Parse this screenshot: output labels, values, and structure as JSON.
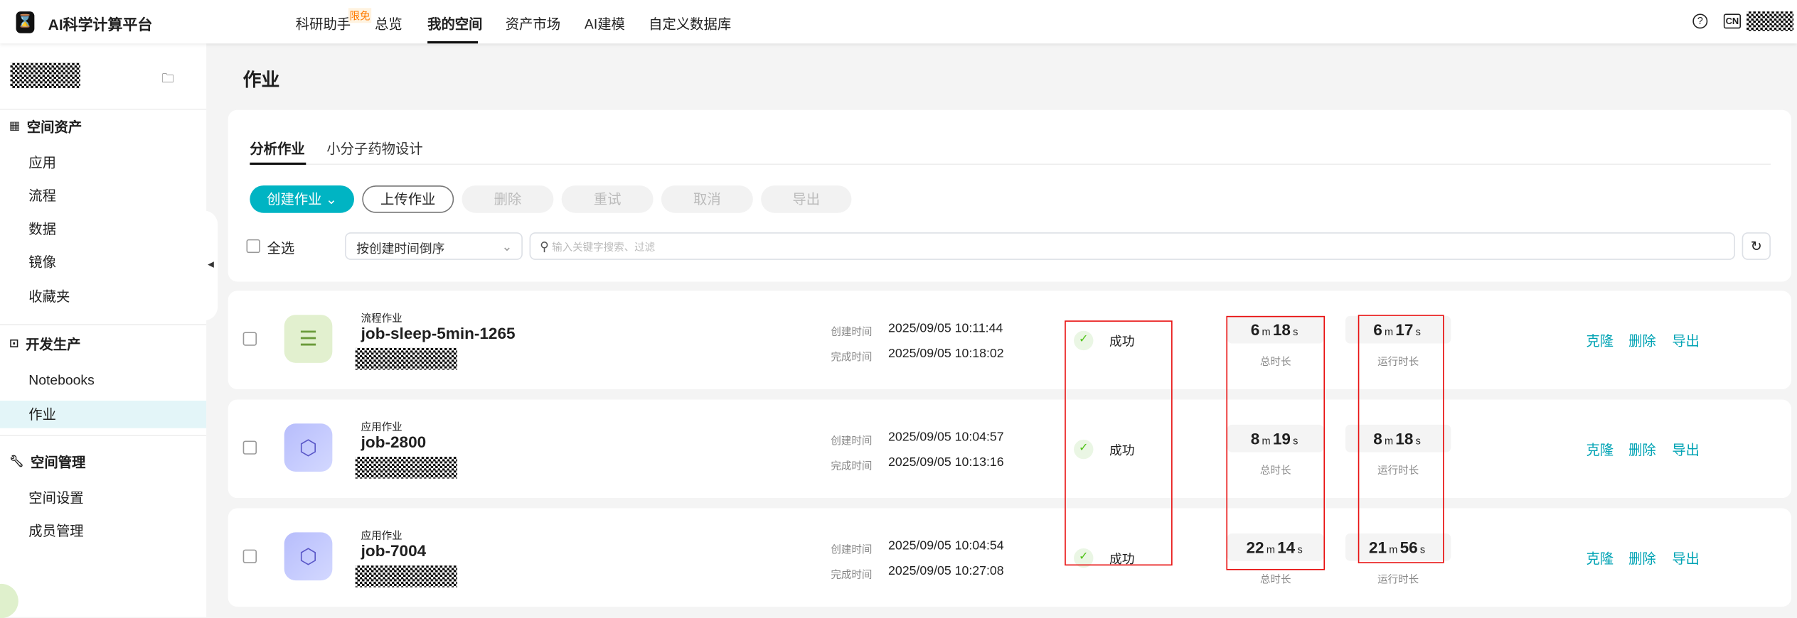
{
  "header": {
    "app_title": "AI科学计算平台",
    "nav": [
      {
        "label": "科研助手",
        "badge": "限免"
      },
      {
        "label": "总览"
      },
      {
        "label": "我的空间",
        "active": true
      },
      {
        "label": "资产市场"
      },
      {
        "label": "AI建模"
      },
      {
        "label": "自定义数据库"
      }
    ],
    "lang": "CN"
  },
  "sidebar": {
    "sections": [
      {
        "title": "空间资产",
        "items": [
          "应用",
          "流程",
          "数据",
          "镜像",
          "收藏夹"
        ]
      },
      {
        "title": "开发生产",
        "items": [
          "Notebooks",
          "作业"
        ]
      },
      {
        "title": "空间管理",
        "items": [
          "空间设置",
          "成员管理"
        ]
      }
    ],
    "active_item": "作业"
  },
  "page": {
    "title": "作业",
    "tabs": [
      "分析作业",
      "小分子药物设计"
    ],
    "active_tab": "分析作业",
    "buttons": {
      "create": "创建作业",
      "upload": "上传作业",
      "delete": "删除",
      "retry": "重试",
      "cancel": "取消",
      "export": "导出"
    },
    "select_all": "全选",
    "sort": "按创建时间倒序",
    "search_placeholder": "输入关键字搜索、过滤"
  },
  "labels": {
    "created": "创建时间",
    "finished": "完成时间",
    "total": "总时长",
    "run": "运行时长",
    "m": "m",
    "s": "s",
    "clone": "克隆",
    "delete": "删除",
    "export": "导出"
  },
  "jobs": [
    {
      "type": "流程作业",
      "name": "job-sleep-5min-1265",
      "created": "2025/09/05 10:11:44",
      "finished": "2025/09/05 10:18:02",
      "status": "成功",
      "total_m": "6",
      "total_s": "18",
      "run_m": "6",
      "run_s": "17"
    },
    {
      "type": "应用作业",
      "name": "job-2800",
      "created": "2025/09/05 10:04:57",
      "finished": "2025/09/05 10:13:16",
      "status": "成功",
      "total_m": "8",
      "total_s": "19",
      "run_m": "8",
      "run_s": "18"
    },
    {
      "type": "应用作业",
      "name": "job-7004",
      "created": "2025/09/05 10:04:54",
      "finished": "2025/09/05 10:27:08",
      "status": "成功",
      "total_m": "22",
      "total_s": "14",
      "run_m": "21",
      "run_s": "56"
    }
  ],
  "colors": {
    "accent": "#00b4c3",
    "link": "#00a3b4",
    "success": "#52c41a",
    "highlight": "#e81010"
  }
}
